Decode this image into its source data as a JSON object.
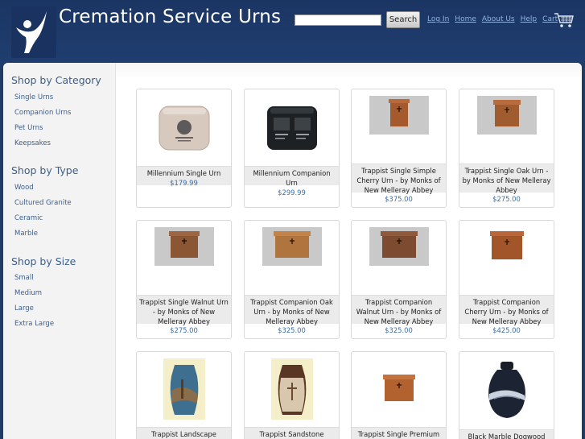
{
  "header": {
    "title": "Cremation Service Urns",
    "search_placeholder": "",
    "search_button": "Search",
    "nav": [
      "Log In",
      "Home",
      "About Us",
      "Help",
      "Cart"
    ]
  },
  "sidebar": {
    "sections": [
      {
        "heading": "Shop by Category",
        "items": [
          "Single Urns",
          "Companion Urns",
          "Pet Urns",
          "Keepsakes"
        ]
      },
      {
        "heading": "Shop by Type",
        "items": [
          "Wood",
          "Cultured Granite",
          "Ceramic",
          "Marble"
        ]
      },
      {
        "heading": "Shop by Size",
        "items": [
          "Small",
          "Medium",
          "Large",
          "Extra Large"
        ]
      }
    ]
  },
  "products": [
    {
      "name": "Millennium Single Urn",
      "price": "$179.99"
    },
    {
      "name": "Millennium Companion Urn",
      "price": "$299.99"
    },
    {
      "name": "Trappist Single Simple Cherry Urn - by Monks of New Melleray Abbey",
      "price": "$375.00"
    },
    {
      "name": "Trappist Single Oak Urn - by Monks of New Melleray Abbey",
      "price": "$275.00"
    },
    {
      "name": "Trappist Single Walnut Urn - by Monks of New Melleray Abbey",
      "price": "$275.00"
    },
    {
      "name": "Trappist Companion Oak Urn - by Monks of New Melleray Abbey",
      "price": "$325.00"
    },
    {
      "name": "Trappist Companion Walnut Urn - by Monks of New Melleray Abbey",
      "price": "$325.00"
    },
    {
      "name": "Trappist Companion Cherry Urn - by Monks of New Melleray Abbey",
      "price": "$425.00"
    },
    {
      "name": "Trappist Landscape",
      "price": ""
    },
    {
      "name": "Trappist Sandstone",
      "price": ""
    },
    {
      "name": "Trappist Single Premium",
      "price": ""
    },
    {
      "name": "Black Marble Dogwood",
      "price": ""
    }
  ],
  "colors": {
    "header_bg": "#1f3b66",
    "link_blue": "#3b5e8c",
    "price_blue": "#3b6ea5",
    "nav_link": "#8fb2e0"
  }
}
